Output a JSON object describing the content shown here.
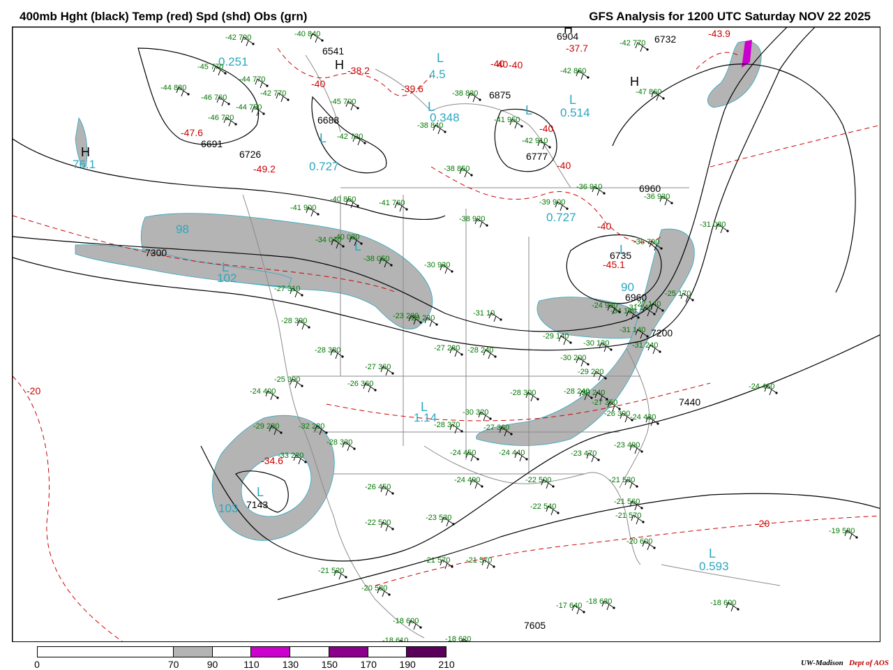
{
  "header": {
    "left_title": "400mb Hght (black) Temp (red) Spd (shd) Obs (grn)",
    "right_title": "GFS Analysis for 1200 UTC Saturday  NOV 22 2025"
  },
  "colorbar": {
    "ticks": [
      "0",
      "70",
      "90",
      "110",
      "130",
      "150",
      "170",
      "190",
      "210"
    ],
    "segments": [
      {
        "from": 0,
        "to": 70,
        "color": "#ffffff"
      },
      {
        "from": 70,
        "to": 90,
        "color": "#b4b4b4"
      },
      {
        "from": 90,
        "to": 110,
        "color": "#ffffff"
      },
      {
        "from": 110,
        "to": 130,
        "color": "#cc00cc"
      },
      {
        "from": 130,
        "to": 150,
        "color": "#ffffff"
      },
      {
        "from": 150,
        "to": 170,
        "color": "#8b008b"
      },
      {
        "from": 170,
        "to": 190,
        "color": "#ffffff"
      },
      {
        "from": 190,
        "to": 210,
        "color": "#5a005a"
      }
    ]
  },
  "credit": {
    "org": "UW-Madison",
    "dept": "Dept of AOS"
  },
  "colors": {
    "height": "#000000",
    "temperature": "#cc0000",
    "speed_shade": "#b4b4b4",
    "observation": "#007700",
    "extrema": "#2aa7c0",
    "border": "#888888"
  },
  "height_labels": [
    "6541",
    "6904",
    "6732",
    "6688",
    "6875",
    "6691",
    "6726",
    "6777",
    "6960",
    "6735",
    "6960",
    "7200",
    "7300",
    "7440",
    "7143",
    "7605"
  ],
  "temp_labels": [
    "-43.9",
    "-37.7",
    "-38.2",
    "-39.6",
    "-40",
    "-40",
    "-40",
    "-40",
    "-40",
    "-40",
    "-40",
    "-47.6",
    "-49.2",
    "-45.1",
    "-34.6",
    "-20",
    "-20"
  ],
  "extrema_labels": [
    "H",
    "H",
    "H",
    "H",
    "L",
    "L",
    "L",
    "L",
    "L",
    "L",
    "L",
    "L",
    "L",
    "L",
    "L"
  ],
  "extrema_values": [
    "0.251",
    "76.1",
    "0.727",
    "0.348",
    "0.514",
    "0.727",
    "98",
    "102",
    "1.14",
    "103",
    "0.593",
    "4.5",
    "90"
  ],
  "observations": [
    "-42 790",
    "-40 840",
    "-45 770",
    "-44 770",
    "-42 770",
    "-44 880",
    "-46 760",
    "-44 750",
    "-46 720",
    "-45 700",
    "-42 730",
    "-38 840",
    "-41 950",
    "-42 910",
    "-38 850",
    "-36 910",
    "-39 900",
    "-38 920",
    "-38 830",
    "-42 860",
    "-42 770",
    "-47 860",
    "-36 930",
    "-31 080",
    "-36 790",
    "-25 170",
    "-34 040",
    "-41 900",
    "-40 850",
    "-41 760",
    "-40 030",
    "-38 050",
    "-30 930",
    "-27 310",
    "-28 390",
    "-29 230",
    "-23 230",
    "-27 280",
    "-28 240",
    "-31 10",
    "-28 380",
    "-27 360",
    "-26 360",
    "-25 390",
    "-24 400",
    "-29 280",
    "-32 280",
    "-33 220",
    "-28 330",
    "-30 320",
    "-28 370",
    "-27 360",
    "-28 300",
    "-28 240",
    "-27 350",
    "-26 390",
    "-24 430",
    "-23 490",
    "-24 450",
    "-24 440",
    "-22 500",
    "-23 470",
    "-21 530",
    "-24 490",
    "-26 450",
    "-22 500",
    "-23 530",
    "-22 540",
    "-21 560",
    "-21 570",
    "-20 600",
    "-21 570",
    "-21 570",
    "-21 520",
    "-20 580",
    "-18 600",
    "-18 610",
    "-18 620",
    "-17 640",
    "-18 630",
    "-18 600",
    "-19 580",
    "-24 460",
    "-29 140",
    "-30 130",
    "-31 140",
    "-34 130",
    "-31 140",
    "-31 240",
    "-30 200",
    "-29 220",
    "-29 240",
    "-24 930",
    "-27 140"
  ]
}
